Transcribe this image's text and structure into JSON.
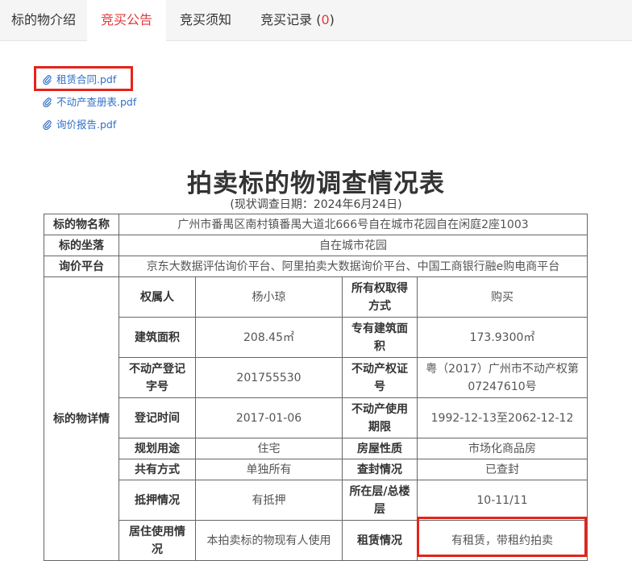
{
  "tabs": [
    {
      "label": "标的物介绍"
    },
    {
      "label": "竞买公告"
    },
    {
      "label": "竞买须知"
    },
    {
      "label": "竞买记录 (",
      "count": "0",
      "suffix": ")"
    }
  ],
  "attachments": [
    {
      "name": "租赁合同.pdf"
    },
    {
      "name": "不动产查册表.pdf"
    },
    {
      "name": "询价报告.pdf"
    }
  ],
  "document": {
    "title": "拍卖标的物调查情况表",
    "subtitle": "(现状调查日期：2024年6月24日)",
    "rows": {
      "name_label": "标的物名称",
      "name_value": "广州市番禺区南村镇番禺大道北666号自在城市花园自在闲庭2座1003",
      "location_label": "标的坐落",
      "location_value": "自在城市花园",
      "platform_label": "询价平台",
      "platform_value": "京东大数据评估询价平台、阿里拍卖大数据询价平台、中国工商银行融e购电商平台",
      "details_label": "标的物详情"
    },
    "details": {
      "owner_label": "权属人",
      "owner_value": "杨小琼",
      "acquire_label": "所有权取得方式",
      "acquire_value": "购买",
      "area_label": "建筑面积",
      "area_value": "208.45㎡",
      "exclusive_label": "专有建筑面积",
      "exclusive_value": "173.9300㎡",
      "reg_no_label": "不动产登记字号",
      "reg_no_value": "201755530",
      "cert_label": "不动产权证号",
      "cert_value": "粤（2017）广州市不动产权第07247610号",
      "reg_time_label": "登记时间",
      "reg_time_value": "2017-01-06",
      "term_label": "不动产使用期限",
      "term_value": "1992-12-13至2062-12-12",
      "usage_label": "规划用途",
      "usage_value": "住宅",
      "nature_label": "房屋性质",
      "nature_value": "市场化商品房",
      "share_label": "共有方式",
      "share_value": "单独所有",
      "seal_label": "查封情况",
      "seal_value": "已查封",
      "mortgage_label": "抵押情况",
      "mortgage_value": "有抵押",
      "floor_label": "所在层/总楼层",
      "floor_value": "10-11/11",
      "occupancy_label": "居住使用情况",
      "occupancy_value": "本拍卖标的物现有人使用",
      "lease_label": "租赁情况",
      "lease_value": "有租赁，带租约拍卖"
    }
  },
  "colors": {
    "accent_red": "#e4393c",
    "highlight_red": "#e5231a",
    "link_blue": "#2e6fc7"
  }
}
